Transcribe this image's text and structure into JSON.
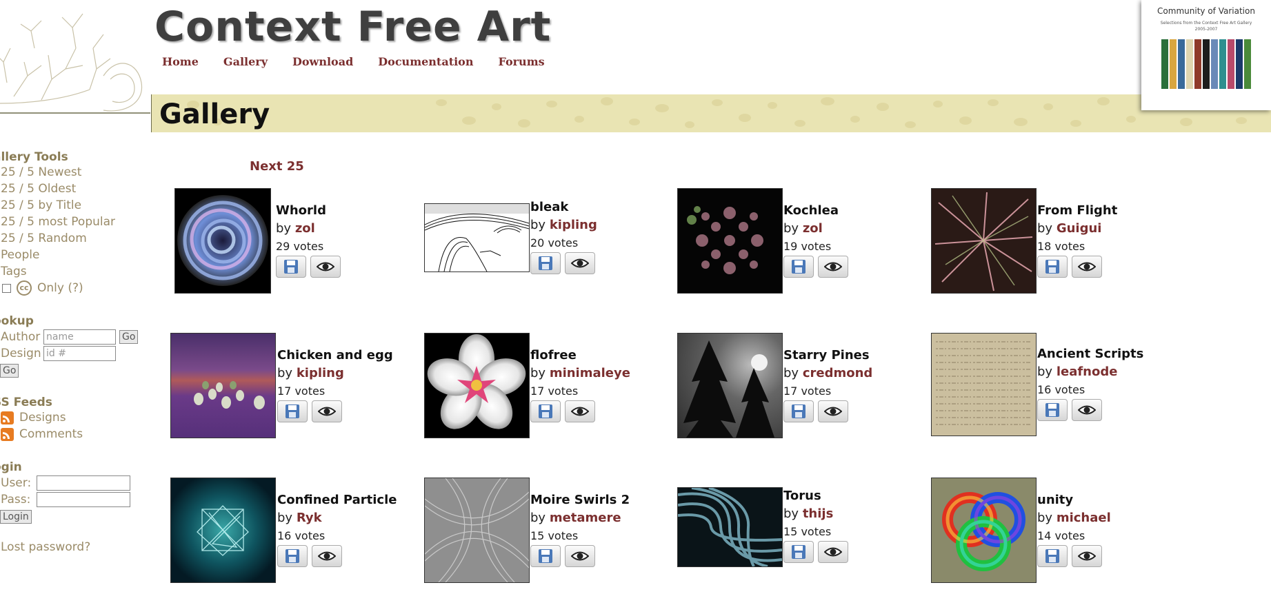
{
  "site": {
    "title": "Context Free Art"
  },
  "nav": [
    "Home",
    "Gallery",
    "Download",
    "Documentation",
    "Forums"
  ],
  "page_title": "Gallery",
  "book": {
    "title": "Community of Variation",
    "subtitle": "Selections from the Context Free Art Gallery 2005-2007",
    "colors": [
      "#2a6f3a",
      "#d8a640",
      "#3a6a9a",
      "#e0d6b0",
      "#8f3a2a",
      "#1d1d1d",
      "#6a8ab8",
      "#2f8f8f",
      "#b84a6a",
      "#1a3a6a",
      "#4a8a3a"
    ]
  },
  "sidebar": {
    "tools_heading": "allery Tools",
    "tools": [
      "25 / 5 Newest",
      "25 / 5 Oldest",
      "25 / 5 by Title",
      "25 / 5 most Popular",
      "25 / 5 Random",
      "People",
      "Tags"
    ],
    "cc_badge": "cc",
    "cc_only_label": "Only (?)",
    "lookup_heading": "ookup",
    "author_label": "Author",
    "author_placeholder": "name",
    "go_label": "Go",
    "design_label": "Design",
    "design_placeholder": "id #",
    "go2_label": "Go",
    "rss_heading": "SS Feeds",
    "rss_items": [
      "Designs",
      "Comments"
    ],
    "login_heading": "ogin",
    "user_label": "User:",
    "pass_label": "Pass:",
    "login_button": "Login",
    "lost_password": "Lost password?"
  },
  "next_link": "Next 25",
  "gallery": [
    {
      "title": "Whorld",
      "by": "by",
      "author": "zol",
      "votes": "29 votes"
    },
    {
      "title": "bleak",
      "by": "by",
      "author": "kipling",
      "votes": "20 votes"
    },
    {
      "title": "Kochlea",
      "by": "by",
      "author": "zol",
      "votes": "19 votes"
    },
    {
      "title": "From Flight",
      "by": "by",
      "author": "Guigui",
      "votes": "18 votes"
    },
    {
      "title": "Chicken and egg",
      "by": "by",
      "author": "kipling",
      "votes": "17 votes"
    },
    {
      "title": "flofree",
      "by": "by",
      "author": "minimaleye",
      "votes": "17 votes"
    },
    {
      "title": "Starry Pines",
      "by": "by",
      "author": "credmond",
      "votes": "17 votes"
    },
    {
      "title": "Ancient Scripts",
      "by": "by",
      "author": "leafnode",
      "votes": "16 votes"
    },
    {
      "title": "Confined Particle",
      "by": "by",
      "author": "Ryk",
      "votes": "16 votes"
    },
    {
      "title": "Moire Swirls 2",
      "by": "by",
      "author": "metamere",
      "votes": "15 votes"
    },
    {
      "title": "Torus",
      "by": "by",
      "author": "thijs",
      "votes": "15 votes"
    },
    {
      "title": "unity",
      "by": "by",
      "author": "michael",
      "votes": "14 votes"
    }
  ]
}
